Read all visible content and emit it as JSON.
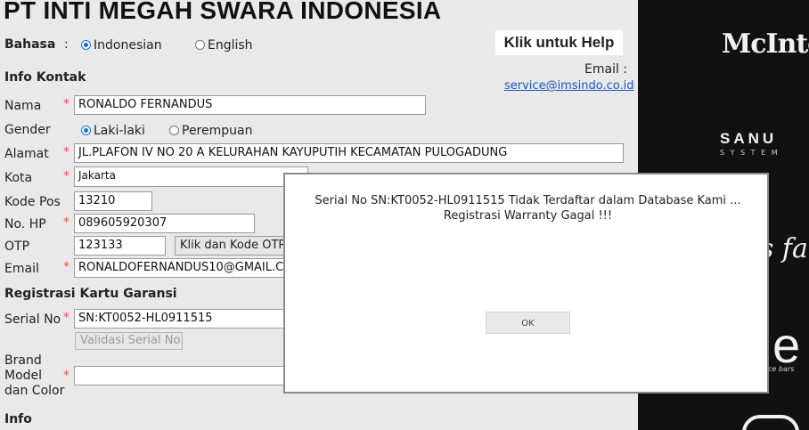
{
  "header": {
    "title": "PT INTI MEGAH SWARA INDONESIA"
  },
  "language": {
    "label": "Bahasa",
    "colon": ":",
    "options": [
      "Indonesian",
      "English"
    ],
    "selected": "Indonesian"
  },
  "help": {
    "label": "Klik untuk Help"
  },
  "contact_email": {
    "label": "Email :",
    "value": "service@imsindo.co.id"
  },
  "sections": {
    "info_kontak": "Info Kontak",
    "registrasi": "Registrasi Kartu Garansi",
    "info": "Info"
  },
  "fields": {
    "nama": {
      "label": "Nama",
      "value": "RONALDO FERNANDUS"
    },
    "gender": {
      "label": "Gender",
      "options": [
        "Laki-laki",
        "Perempuan"
      ],
      "selected": "Laki-laki"
    },
    "alamat": {
      "label": "Alamat",
      "value": "JL.PLAFON IV NO 20 A KELURAHAN KAYUPUTIH KECAMATAN PULOGADUNG"
    },
    "kota": {
      "label": "Kota",
      "value": "Jakarta"
    },
    "kode_pos": {
      "label": "Kode Pos",
      "value": "13210"
    },
    "no_hp": {
      "label": "No. HP",
      "value": "089605920307"
    },
    "otp": {
      "label": "OTP",
      "value": "123133",
      "button": "Klik dan Kode OTP"
    },
    "email": {
      "label": "Email",
      "value": "RONALDOFERNANDUS10@GMAIL.C"
    },
    "serial_no": {
      "label": "Serial No",
      "value": "SN:KT0052-HL0911515",
      "button": "Validasi Serial No."
    },
    "brand_model": {
      "label_lines": [
        "Brand",
        "Model",
        "dan Color"
      ],
      "value": ""
    }
  },
  "required_mark": "*",
  "brands": {
    "mcintosh": "McIntos",
    "sanus": "SANU",
    "sanus_sub": "S Y S T E M",
    "fab": "s fal",
    "partial_e": "e",
    "partial_sub": "ce bars"
  },
  "dialog": {
    "message_line1": "Serial No SN:KT0052-HL0911515 Tidak Terdaftar dalam Database Kami ...",
    "message_line2": "Registrasi Warranty Gagal !!!",
    "ok_label": "OK"
  },
  "colors": {
    "required": "#e05050",
    "link": "#1a55c8",
    "radio_selected": "#1a6ed8",
    "brand_panel": "#111111"
  }
}
